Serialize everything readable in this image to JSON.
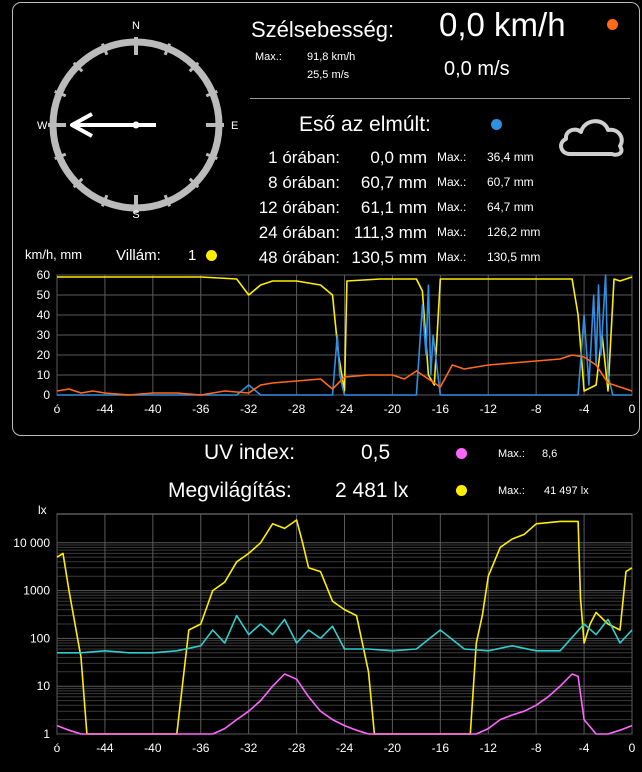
{
  "colors": {
    "wind": "#ff6a1a",
    "rain": "#2f8fe0",
    "uv": "#ff66ff",
    "lux": "#ffee00",
    "lightning": "#ffee00",
    "accent_cyan": "#33cccc"
  },
  "wind": {
    "title": "Szélsebesség:",
    "value_kmh": "0,0 km/h",
    "value_ms": "0,0 m/s",
    "max_label": "Max.:",
    "max_kmh": "91,8 km/h",
    "max_ms": "25,5 m/s"
  },
  "compass": {
    "n": "N",
    "s": "S",
    "e": "E",
    "w": "W",
    "icon": "compass-dial-icon",
    "direction": "W"
  },
  "rain": {
    "title": "Eső az elmúlt:",
    "max_label": "Max.:",
    "rows": [
      {
        "period": "1 órában:",
        "value": "0,0 mm",
        "max": "36,4 mm"
      },
      {
        "period": "8 órában:",
        "value": "60,7 mm",
        "max": "60,7 mm"
      },
      {
        "period": "12 órában:",
        "value": "61,1 mm",
        "max": "64,7 mm"
      },
      {
        "period": "24 órában:",
        "value": "111,3 mm",
        "max": "126,2 mm"
      },
      {
        "period": "48 órában:",
        "value": "130,5 mm",
        "max": "130,5 mm"
      }
    ],
    "icon": "cloud-icon"
  },
  "lightning": {
    "label": "Villám:",
    "count": "1"
  },
  "chart1_unit": "km/h, mm",
  "uv": {
    "label": "UV index:",
    "value": "0,5",
    "max_label": "Max.:",
    "max": "8,6"
  },
  "lux": {
    "label": "Megvilágítás:",
    "value": "2 481 lx",
    "max_label": "Max.:",
    "max": "41 497 lx"
  },
  "chart2_unit": "lx",
  "chart_data": [
    {
      "type": "line",
      "xlabel": "",
      "ylabel": "km/h, mm",
      "x_ticks": [
        "ó",
        "-44",
        "-40",
        "-36",
        "-32",
        "-28",
        "-24",
        "-20",
        "-16",
        "-12",
        "-8",
        "-4",
        "0"
      ],
      "y_ticks": [
        "0",
        "10",
        "20",
        "30",
        "40",
        "50",
        "60"
      ],
      "ylim": [
        0,
        60
      ],
      "xlim": [
        -48,
        0
      ],
      "grid": true,
      "series": [
        {
          "color": "#ffee00",
          "x": [
            -48,
            -44,
            -40,
            -36,
            -33,
            -32,
            -31,
            -30,
            -28,
            -26,
            -25,
            -24.5,
            -24,
            -23.8,
            -21,
            -18,
            -17.5,
            -17,
            -16.5,
            -16,
            -12,
            -8,
            -5,
            -4.5,
            -4,
            -3,
            -2.5,
            -2,
            -1.5,
            -1,
            0
          ],
          "y": [
            59,
            59,
            59,
            59,
            58,
            50,
            55,
            57,
            57,
            55,
            50,
            20,
            2,
            57,
            58,
            58,
            52,
            10,
            5,
            58,
            58,
            58,
            58,
            40,
            2,
            5,
            30,
            2,
            58,
            57,
            59
          ]
        },
        {
          "color": "#2f8fe0",
          "x": [
            -48,
            -33,
            -32,
            -31,
            -25,
            -24.6,
            -24.4,
            -24,
            -18,
            -17.5,
            -17.2,
            -17,
            -16.8,
            -16.6,
            -16,
            -4.5,
            -4,
            -3.6,
            -3.2,
            -3,
            -2.8,
            -2.6,
            -2.2,
            -2,
            -1.6,
            0
          ],
          "y": [
            0,
            0,
            5,
            0,
            0,
            30,
            10,
            0,
            0,
            45,
            20,
            55,
            10,
            30,
            0,
            0,
            40,
            5,
            50,
            15,
            55,
            20,
            60,
            10,
            0,
            0
          ]
        },
        {
          "color": "#ff6a1a",
          "x": [
            -48,
            -47,
            -46,
            -45,
            -44,
            -42,
            -40,
            -38,
            -36,
            -34,
            -32,
            -31,
            -30,
            -28,
            -26,
            -25,
            -24,
            -22,
            -20,
            -19,
            -18,
            -17,
            -16,
            -15,
            -14,
            -12,
            -10,
            -8,
            -6,
            -5,
            -4,
            -3,
            -2,
            -1,
            0
          ],
          "y": [
            2,
            3,
            1,
            2,
            1,
            0,
            1,
            1,
            0,
            2,
            1,
            5,
            6,
            7,
            8,
            3,
            9,
            10,
            10,
            8,
            12,
            8,
            4,
            15,
            13,
            15,
            16,
            17,
            18,
            20,
            19,
            15,
            6,
            4,
            2
          ]
        }
      ]
    },
    {
      "type": "line",
      "xlabel": "",
      "ylabel": "lx",
      "x_ticks": [
        "ó",
        "-44",
        "-40",
        "-36",
        "-32",
        "-28",
        "-24",
        "-20",
        "-16",
        "-12",
        "-8",
        "-4",
        "0"
      ],
      "y_ticks": [
        "1",
        "10",
        "100",
        "1000",
        "10 000"
      ],
      "yscale": "log",
      "ylim": [
        1,
        40000
      ],
      "xlim": [
        -48,
        0
      ],
      "grid": true,
      "series": [
        {
          "color": "#ffee00",
          "x": [
            -48,
            -47.5,
            -47,
            -46,
            -45.5,
            -38,
            -37,
            -36,
            -35,
            -34,
            -33,
            -32,
            -31,
            -30,
            -29,
            -28,
            -27.5,
            -27,
            -26,
            -25,
            -24,
            -23,
            -22,
            -21.5,
            -21,
            -13.5,
            -13,
            -12.5,
            -12,
            -11,
            -10,
            -9,
            -8,
            -6,
            -4.5,
            -4.3,
            -4,
            -3.5,
            -3,
            -2,
            -1,
            -0.5,
            0
          ],
          "y": [
            5000,
            6000,
            1000,
            40,
            1,
            1,
            150,
            200,
            1000,
            1500,
            4000,
            6000,
            10000,
            25000,
            20000,
            30000,
            10000,
            3000,
            2500,
            600,
            400,
            300,
            20,
            1,
            1,
            1,
            80,
            300,
            2000,
            8000,
            12000,
            15000,
            25000,
            28000,
            28000,
            700,
            80,
            200,
            350,
            200,
            150,
            2500,
            3000
          ]
        },
        {
          "color": "#33cccc",
          "x": [
            -48,
            -46,
            -44,
            -42,
            -40,
            -38,
            -36,
            -35,
            -34,
            -33,
            -32,
            -31,
            -30,
            -29,
            -28,
            -27,
            -26,
            -25,
            -24,
            -22,
            -20,
            -18,
            -16,
            -14,
            -12,
            -10,
            -8,
            -6,
            -4,
            -3,
            -2,
            -1,
            0
          ],
          "y": [
            50,
            50,
            55,
            50,
            50,
            55,
            70,
            150,
            80,
            300,
            120,
            200,
            120,
            250,
            80,
            150,
            100,
            180,
            60,
            60,
            55,
            60,
            150,
            60,
            55,
            70,
            55,
            55,
            200,
            120,
            250,
            80,
            150
          ]
        },
        {
          "color": "#ff66ff",
          "x": [
            -48,
            -47,
            -46,
            -40,
            -35,
            -34,
            -33,
            -32,
            -31,
            -30,
            -29,
            -28,
            -27,
            -26,
            -25,
            -24,
            -23,
            -22,
            -21,
            -13,
            -12,
            -11,
            -10,
            -9,
            -8,
            -7,
            -6,
            -5,
            -4.5,
            -4,
            -3,
            -2,
            -1,
            0
          ],
          "y": [
            1.5,
            1.2,
            1,
            1,
            1,
            1.3,
            2,
            3,
            5,
            10,
            18,
            14,
            6,
            3,
            2,
            1.5,
            1.2,
            1,
            1,
            1,
            1.3,
            2,
            2.5,
            3,
            4,
            6,
            10,
            18,
            16,
            2,
            1,
            1,
            1.2,
            1.5
          ]
        }
      ]
    }
  ]
}
